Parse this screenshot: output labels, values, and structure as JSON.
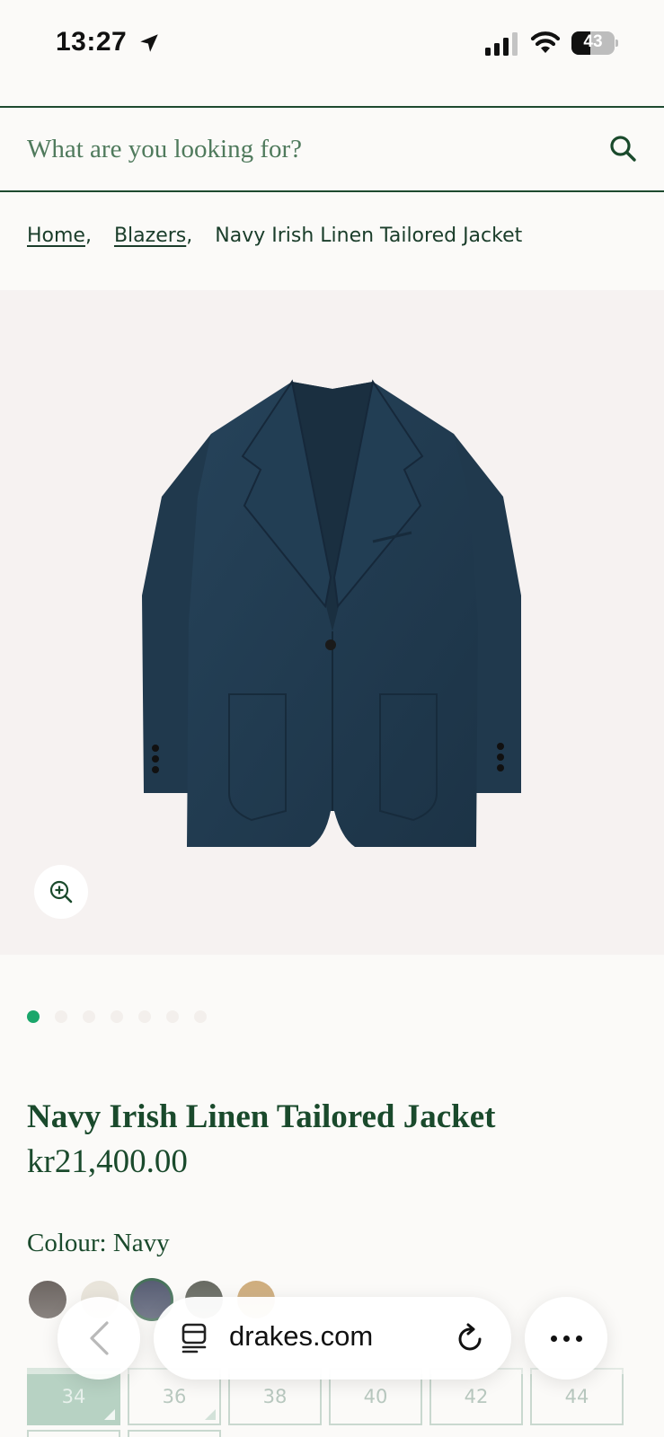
{
  "status_bar": {
    "time": "13:27",
    "battery": "43",
    "battery_level": 0.43
  },
  "search": {
    "placeholder": "What are you looking for?"
  },
  "breadcrumb": {
    "items": [
      "Home",
      "Blazers"
    ],
    "current": "Navy Irish Linen Tailored Jacket"
  },
  "carousel": {
    "total_images": 7,
    "active_index": 0
  },
  "product": {
    "title": "Navy Irish Linen Tailored Jacket",
    "price": "kr21,400.00",
    "colour_label": "Colour: Navy",
    "swatches": [
      {
        "name": "brown",
        "color": "#5b534f",
        "selected": false
      },
      {
        "name": "ecru",
        "color": "#e6e1d6",
        "selected": false
      },
      {
        "name": "navy",
        "color": "#434a63",
        "selected": true
      },
      {
        "name": "olive",
        "color": "#55584f",
        "selected": false
      },
      {
        "name": "tan",
        "color": "#c9a36d",
        "selected": false
      }
    ],
    "sizes": [
      "34",
      "36",
      "38",
      "40",
      "42",
      "44"
    ],
    "selected_size": "34"
  },
  "browser": {
    "url": "drakes.com"
  },
  "colors": {
    "brand_green": "#1a4a2c",
    "active_dot": "#1aa66b",
    "jacket_navy": "#1f3a4d"
  }
}
